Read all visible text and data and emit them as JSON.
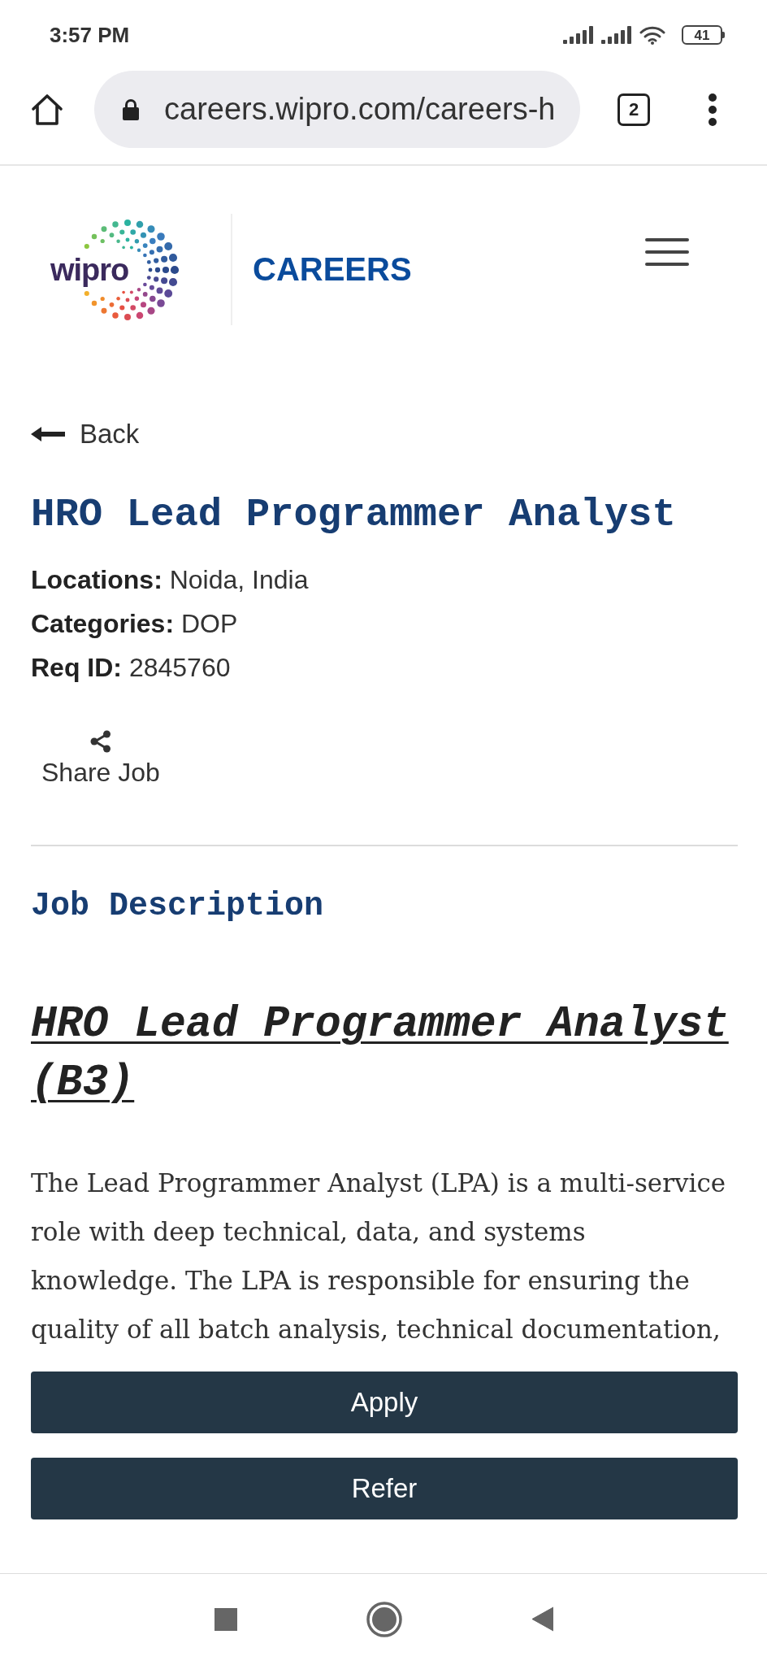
{
  "status_bar": {
    "time": "3:57 PM",
    "battery": "41"
  },
  "browser_bar": {
    "url": "careers.wipro.com/careers-h",
    "tab_count": "2"
  },
  "header": {
    "logo_text": "wipro",
    "section": "CAREERS"
  },
  "job": {
    "back": "Back",
    "title": "HRO Lead Programmer Analyst",
    "details": [
      "**Locations:** Noida, India",
      "**Categories:** DOP",
      "**Req ID:** 2845760"
    ],
    "share": "Share Job"
  },
  "description": {
    "heading": "Job Description",
    "subheading": "HRO Lead Programmer Analyst (B3)",
    "paragraph": "The Lead Programmer Analyst (LPA) is a multi-service role with deep technical, data, and systems knowledge. The LPA is responsible for ensuring the quality of all batch analysis, technical documentation,"
  },
  "actions": [
    "Apply",
    "Refer"
  ]
}
